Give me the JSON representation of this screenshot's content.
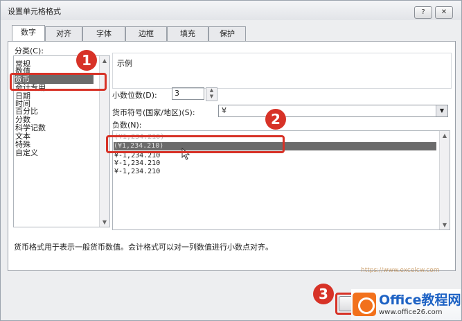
{
  "window": {
    "title": "设置单元格格式",
    "help_glyph": "?",
    "close_glyph": "✕"
  },
  "tabs": [
    "数字",
    "对齐",
    "字体",
    "边框",
    "填充",
    "保护"
  ],
  "category": {
    "label": "分类(C):",
    "items": [
      "常规",
      "数值",
      "货币",
      "会计专用",
      "日期",
      "时间",
      "百分比",
      "分数",
      "科学记数",
      "文本",
      "特殊",
      "自定义"
    ],
    "selected": "货币"
  },
  "sample": {
    "label": "示例",
    "value": ""
  },
  "decimal_places": {
    "label": "小数位数(D):",
    "value": "3"
  },
  "currency_symbol": {
    "label": "货币符号(国家/地区)(S):",
    "value": "¥"
  },
  "negative_numbers": {
    "label": "负数(N):",
    "items": [
      "(¥1,234.210)",
      "(¥1,234.210)",
      "¥-1,234.210",
      "¥-1,234.210",
      "¥-1,234.210"
    ],
    "selected_index": 1
  },
  "description": "货币格式用于表示一般货币数值。会计格式可以对一列数值进行小数点对齐。",
  "callouts": [
    "1",
    "2",
    "3"
  ],
  "watermark": {
    "brand": "Office教程网",
    "url": "www.office26.com",
    "url2": "https://www.excelcw.com"
  },
  "icons": {
    "scroll_up": "scroll-up-arrow",
    "scroll_down": "scroll-down-arrow",
    "dropdown": "chevron-down-icon",
    "spin": "spin-arrows"
  }
}
